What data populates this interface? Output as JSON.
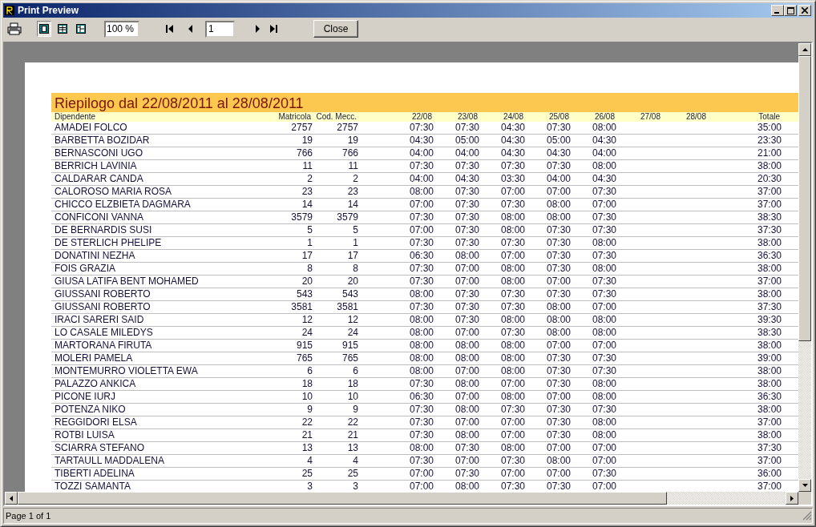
{
  "window": {
    "title": "Print Preview"
  },
  "toolbar": {
    "view_modes": [
      {
        "selected": true
      },
      {
        "selected": false
      },
      {
        "selected": false
      }
    ],
    "zoom": "100 %",
    "page": "1",
    "close": "Close"
  },
  "report": {
    "title": "Riepilogo dal 22/08/2011 al 28/08/2011",
    "columns": [
      "Dipendente",
      "Matricola",
      "Cod. Mecc.",
      "22/08",
      "23/08",
      "24/08",
      "25/08",
      "26/08",
      "27/08",
      "28/08",
      "Totale"
    ],
    "rows": [
      {
        "name": "AMADEI FOLCO",
        "matricola": "2757",
        "cod": "2757",
        "days": [
          "07:30",
          "07:30",
          "04:30",
          "07:30",
          "08:00"
        ],
        "total": "35:00"
      },
      {
        "name": "BARBETTA BOZIDAR",
        "matricola": "19",
        "cod": "19",
        "days": [
          "04:30",
          "05:00",
          "04:30",
          "05:00",
          "04:30"
        ],
        "total": "23:30"
      },
      {
        "name": "BERNASCONI UGO",
        "matricola": "766",
        "cod": "766",
        "days": [
          "04:00",
          "04:00",
          "04:30",
          "04:30",
          "04:00"
        ],
        "total": "21:00"
      },
      {
        "name": "BERRICH LAVINIA",
        "matricola": "11",
        "cod": "11",
        "days": [
          "07:30",
          "07:30",
          "07:30",
          "07:30",
          "08:00"
        ],
        "total": "38:00"
      },
      {
        "name": "CALDARAR CANDA",
        "matricola": "2",
        "cod": "2",
        "days": [
          "04:00",
          "04:30",
          "03:30",
          "04:00",
          "04:30"
        ],
        "total": "20:30"
      },
      {
        "name": "CALOROSO MARIA ROSA",
        "matricola": "23",
        "cod": "23",
        "days": [
          "08:00",
          "07:30",
          "07:00",
          "07:00",
          "07:30"
        ],
        "total": "37:00"
      },
      {
        "name": "CHICCO ELZBIETA DAGMARA",
        "matricola": "14",
        "cod": "14",
        "days": [
          "07:00",
          "07:30",
          "07:30",
          "08:00",
          "07:00"
        ],
        "total": "37:00"
      },
      {
        "name": "CONFICONI VANNA",
        "matricola": "3579",
        "cod": "3579",
        "days": [
          "07:30",
          "07:30",
          "08:00",
          "08:00",
          "07:30"
        ],
        "total": "38:30"
      },
      {
        "name": "DE BERNARDIS SUSI",
        "matricola": "5",
        "cod": "5",
        "days": [
          "07:00",
          "07:30",
          "08:00",
          "07:30",
          "07:30"
        ],
        "total": "37:30"
      },
      {
        "name": "DE STERLICH PHELIPE",
        "matricola": "1",
        "cod": "1",
        "days": [
          "07:30",
          "07:30",
          "07:30",
          "07:30",
          "08:00"
        ],
        "total": "38:00"
      },
      {
        "name": "DONATINI NEZHA",
        "matricola": "17",
        "cod": "17",
        "days": [
          "06:30",
          "08:00",
          "07:00",
          "07:30",
          "07:30"
        ],
        "total": "36:30"
      },
      {
        "name": "FOIS GRAZIA",
        "matricola": "8",
        "cod": "8",
        "days": [
          "07:30",
          "07:00",
          "08:00",
          "07:30",
          "08:00"
        ],
        "total": "38:00"
      },
      {
        "name": "GIUSA LATIFA BENT MOHAMED",
        "matricola": "20",
        "cod": "20",
        "days": [
          "07:30",
          "07:00",
          "08:00",
          "07:00",
          "07:30"
        ],
        "total": "37:00"
      },
      {
        "name": "GIUSSANI ROBERTO",
        "matricola": "543",
        "cod": "543",
        "days": [
          "08:00",
          "07:30",
          "07:30",
          "07:30",
          "07:30"
        ],
        "total": "38:00"
      },
      {
        "name": "GIUSSANI ROBERTO",
        "matricola": "3581",
        "cod": "3581",
        "days": [
          "07:30",
          "07:30",
          "07:30",
          "08:00",
          "07:00"
        ],
        "total": "37:30"
      },
      {
        "name": "IRACI SARERI SAID",
        "matricola": "12",
        "cod": "12",
        "days": [
          "08:00",
          "07:30",
          "08:00",
          "08:00",
          "08:00"
        ],
        "total": "39:30"
      },
      {
        "name": "LO CASALE MILEDYS",
        "matricola": "24",
        "cod": "24",
        "days": [
          "08:00",
          "07:00",
          "07:30",
          "08:00",
          "08:00"
        ],
        "total": "38:30"
      },
      {
        "name": "MARTORANA FIRUTA",
        "matricola": "915",
        "cod": "915",
        "days": [
          "08:00",
          "08:00",
          "08:00",
          "07:00",
          "07:00"
        ],
        "total": "38:00"
      },
      {
        "name": "MOLERI PAMELA",
        "matricola": "765",
        "cod": "765",
        "days": [
          "08:00",
          "08:00",
          "08:00",
          "07:30",
          "07:30"
        ],
        "total": "39:00"
      },
      {
        "name": "MONTEMURRO VIOLETTA EWA",
        "matricola": "6",
        "cod": "6",
        "days": [
          "08:00",
          "07:00",
          "08:00",
          "07:30",
          "07:30"
        ],
        "total": "38:00"
      },
      {
        "name": "PALAZZO ANKICA",
        "matricola": "18",
        "cod": "18",
        "days": [
          "07:30",
          "08:00",
          "07:00",
          "07:30",
          "08:00"
        ],
        "total": "38:00"
      },
      {
        "name": "PICONE IURJ",
        "matricola": "10",
        "cod": "10",
        "days": [
          "06:30",
          "07:00",
          "08:00",
          "07:00",
          "08:00"
        ],
        "total": "36:30"
      },
      {
        "name": "POTENZA NIKO",
        "matricola": "9",
        "cod": "9",
        "days": [
          "07:30",
          "08:00",
          "07:30",
          "07:30",
          "07:30"
        ],
        "total": "38:00"
      },
      {
        "name": "REGGIDORI ELSA",
        "matricola": "22",
        "cod": "22",
        "days": [
          "07:30",
          "07:00",
          "07:00",
          "07:30",
          "08:00"
        ],
        "total": "37:00"
      },
      {
        "name": "ROTBI LUISA",
        "matricola": "21",
        "cod": "21",
        "days": [
          "07:30",
          "08:00",
          "07:00",
          "07:30",
          "08:00"
        ],
        "total": "38:00"
      },
      {
        "name": "SCIARRA STEFANO",
        "matricola": "13",
        "cod": "13",
        "days": [
          "08:00",
          "07:30",
          "08:00",
          "07:00",
          "07:00"
        ],
        "total": "37:30"
      },
      {
        "name": "TARTAULL MADDALENA",
        "matricola": "4",
        "cod": "4",
        "days": [
          "07:30",
          "07:00",
          "07:30",
          "08:00",
          "07:00"
        ],
        "total": "37:00"
      },
      {
        "name": "TIBERTI ADELINA",
        "matricola": "25",
        "cod": "25",
        "days": [
          "07:00",
          "07:30",
          "07:00",
          "07:00",
          "07:30"
        ],
        "total": "36:00"
      },
      {
        "name": "TOZZI SAMANTA",
        "matricola": "3",
        "cod": "3",
        "days": [
          "07:00",
          "08:00",
          "07:30",
          "07:30",
          "07:00"
        ],
        "total": "37:00"
      }
    ]
  },
  "status_bar": {
    "text": "Page 1 of 1"
  }
}
